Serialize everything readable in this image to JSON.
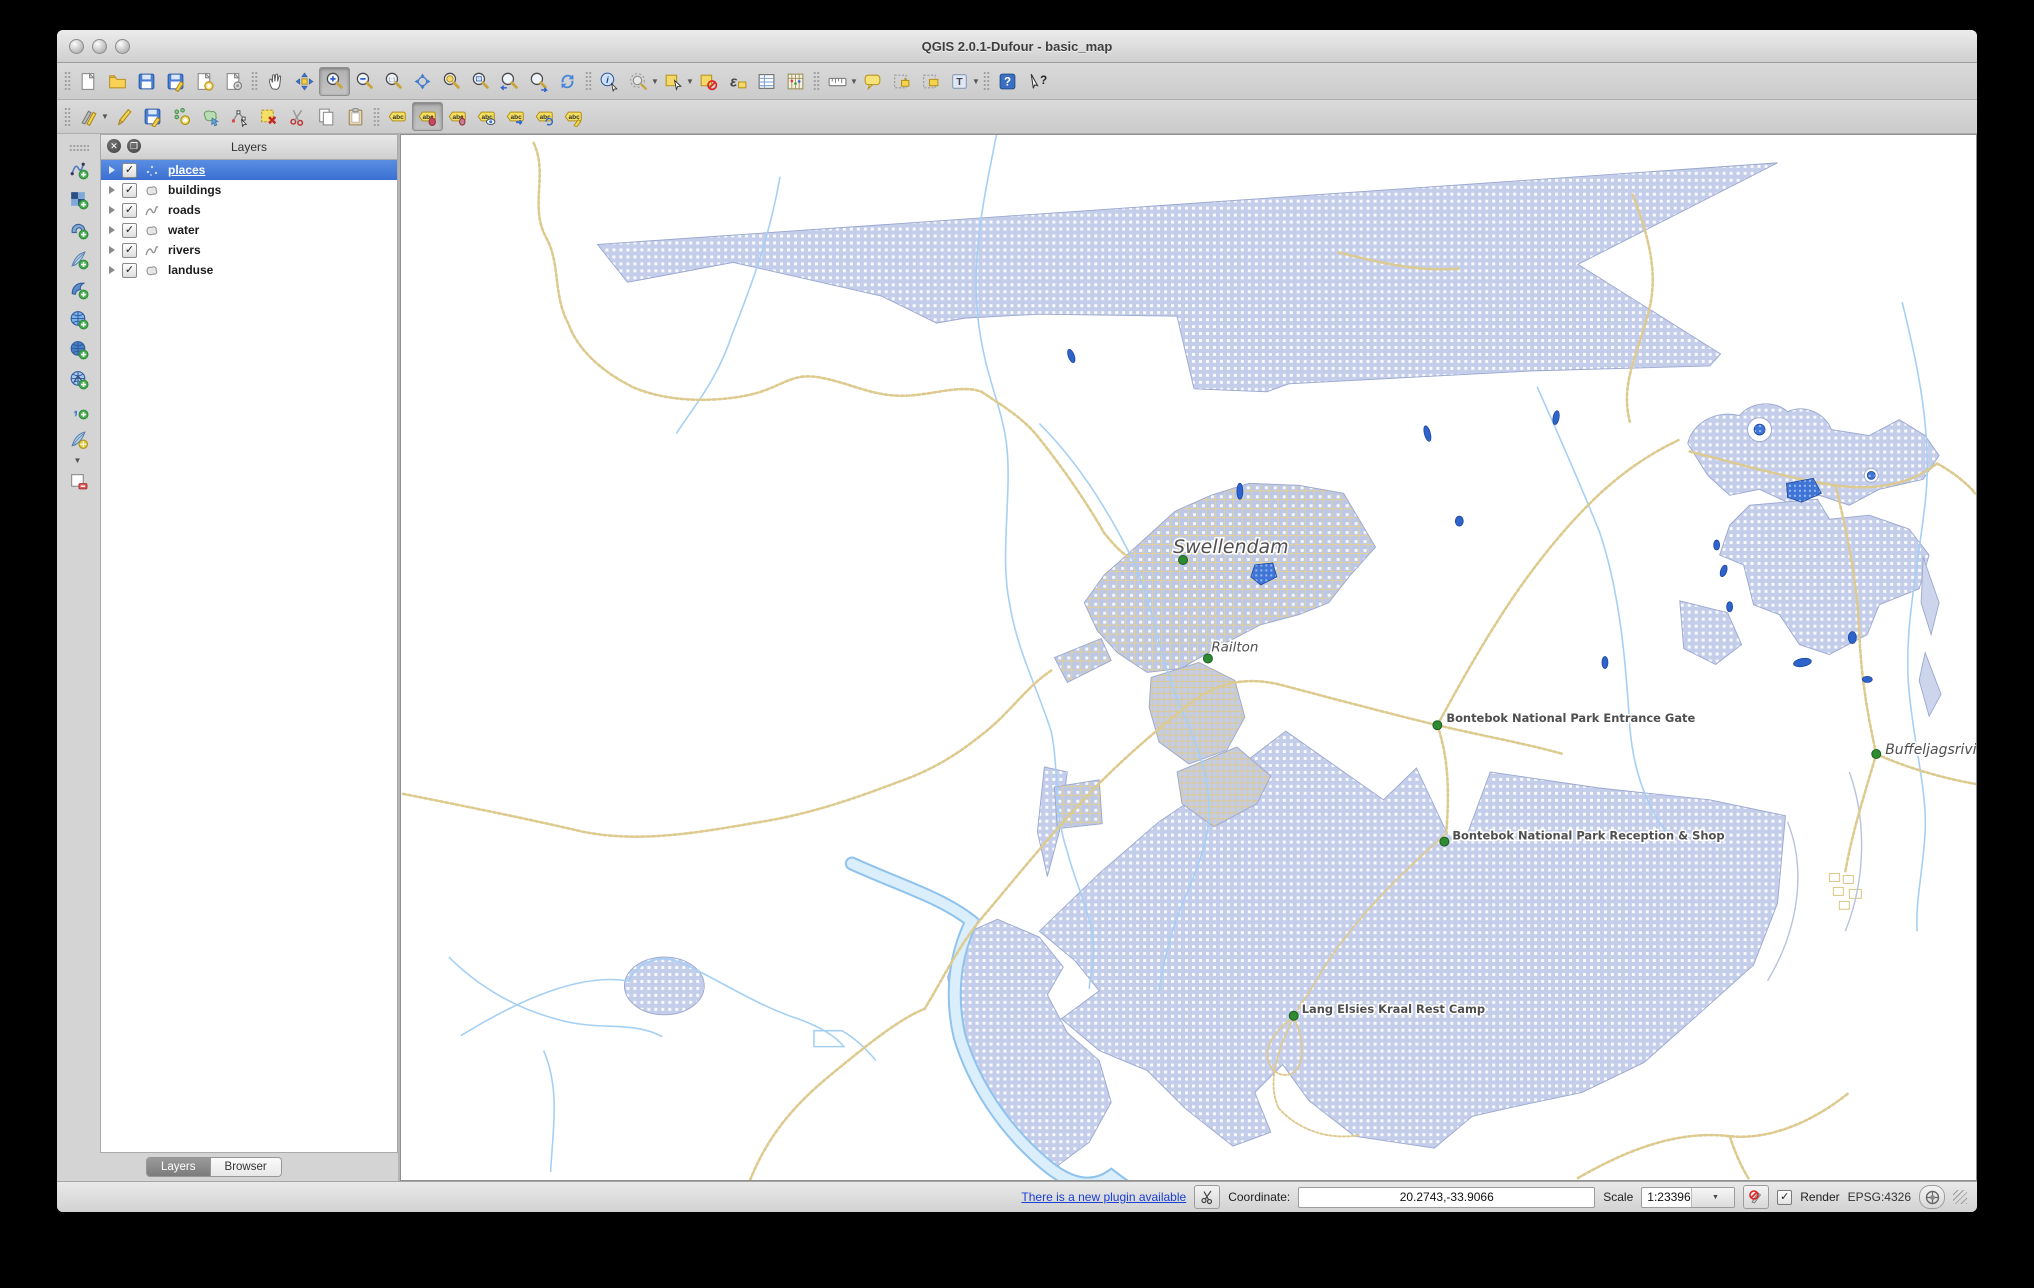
{
  "window": {
    "title": "QGIS 2.0.1-Dufour - basic_map"
  },
  "toolbar_main": [
    {
      "name": "new-project",
      "kind": "file"
    },
    {
      "name": "open-project",
      "kind": "folder"
    },
    {
      "name": "save-project",
      "kind": "floppy"
    },
    {
      "name": "save-project-as",
      "kind": "floppy-pencil"
    },
    {
      "name": "new-composer",
      "kind": "paper-star"
    },
    {
      "name": "composer-manager",
      "kind": "paper-gear"
    },
    {
      "sep": true
    },
    {
      "name": "pan-map",
      "kind": "hand"
    },
    {
      "name": "pan-to-selection",
      "kind": "pan"
    },
    {
      "name": "zoom-in",
      "kind": "mag-plus",
      "active": true
    },
    {
      "name": "zoom-out",
      "kind": "mag-minus"
    },
    {
      "name": "zoom-native",
      "kind": "mag-11"
    },
    {
      "name": "zoom-full",
      "kind": "zoomfull"
    },
    {
      "name": "zoom-to-selection",
      "kind": "mag-sel"
    },
    {
      "name": "zoom-to-layer",
      "kind": "mag-layer"
    },
    {
      "name": "zoom-last",
      "kind": "mag-last"
    },
    {
      "name": "zoom-next",
      "kind": "mag-next"
    },
    {
      "name": "refresh-map",
      "kind": "refresh"
    },
    {
      "sep": true
    },
    {
      "name": "identify-features",
      "kind": "identify"
    },
    {
      "name": "run-feature-action",
      "kind": "action",
      "dd": true
    },
    {
      "name": "select-features",
      "kind": "select",
      "dd": true
    },
    {
      "name": "deselect-features",
      "kind": "deselect"
    },
    {
      "name": "select-by-expression",
      "kind": "expression"
    },
    {
      "name": "open-attribute-table",
      "kind": "table"
    },
    {
      "name": "field-calculator",
      "kind": "calc"
    },
    {
      "sep": true
    },
    {
      "name": "measure",
      "kind": "measure",
      "dd": true
    },
    {
      "name": "map-tips",
      "kind": "bubble"
    },
    {
      "name": "new-bookmark",
      "kind": "bookmark-new"
    },
    {
      "name": "show-bookmarks",
      "kind": "bookmark-show"
    },
    {
      "name": "text-annotation",
      "kind": "textT",
      "dd": true
    },
    {
      "sep": true
    },
    {
      "name": "help",
      "kind": "help"
    },
    {
      "name": "whats-this",
      "kind": "whatsthis"
    }
  ],
  "toolbar_edit": [
    {
      "name": "current-edits",
      "kind": "edits",
      "dd": true
    },
    {
      "name": "toggle-editing",
      "kind": "pencil"
    },
    {
      "name": "save-layer-edits",
      "kind": "saveedits"
    },
    {
      "name": "add-feature",
      "kind": "addfeature"
    },
    {
      "name": "move-feature",
      "kind": "movefeature"
    },
    {
      "name": "node-tool",
      "kind": "nodetool"
    },
    {
      "name": "delete-selected",
      "kind": "delete"
    },
    {
      "name": "cut-features",
      "kind": "cut"
    },
    {
      "name": "copy-features",
      "kind": "copy"
    },
    {
      "name": "paste-features",
      "kind": "paste"
    },
    {
      "sep": true
    },
    {
      "name": "layer-labeling",
      "kind": "label-abc"
    },
    {
      "name": "pin-label",
      "kind": "label-pin",
      "active": true
    },
    {
      "name": "highlight-pinned-labels",
      "kind": "label-pin2"
    },
    {
      "name": "show-hide-labels",
      "kind": "label-eye"
    },
    {
      "name": "move-label",
      "kind": "label-arrow"
    },
    {
      "name": "rotate-label",
      "kind": "label-rotate"
    },
    {
      "name": "change-label",
      "kind": "label-edit"
    }
  ],
  "dock_left": [
    {
      "name": "add-vector-layer",
      "kind": "vline",
      "plus": true
    },
    {
      "name": "add-raster-layer",
      "kind": "checker",
      "plus": true
    },
    {
      "name": "add-postgis-layer",
      "kind": "elephant",
      "plus": true
    },
    {
      "name": "add-spatialite-layer",
      "kind": "feather",
      "plus": true
    },
    {
      "name": "add-mssql-layer",
      "kind": "shell",
      "plus": true
    },
    {
      "name": "add-wms-layer",
      "kind": "globe",
      "plus": true
    },
    {
      "name": "add-wcs-layer",
      "kind": "globe2",
      "plus": true
    },
    {
      "name": "add-wfs-layer",
      "kind": "globe3",
      "plus": true
    },
    {
      "name": "add-delimited-text-layer",
      "kind": "comma",
      "plus": true
    },
    {
      "name": "new-shapefile-layer",
      "kind": "newshp",
      "dd": true
    },
    {
      "name": "remove-layer",
      "kind": "removelayer"
    }
  ],
  "layers_panel": {
    "title": "Layers",
    "items": [
      {
        "label": "places",
        "type": "point",
        "checked": true,
        "selected": true
      },
      {
        "label": "buildings",
        "type": "polygon",
        "checked": true
      },
      {
        "label": "roads",
        "type": "line",
        "checked": true
      },
      {
        "label": "water",
        "type": "polygon",
        "checked": true
      },
      {
        "label": "rivers",
        "type": "line",
        "checked": true
      },
      {
        "label": "landuse",
        "type": "polygon",
        "checked": true
      }
    ]
  },
  "tabs": {
    "layers": "Layers",
    "browser": "Browser"
  },
  "statusbar": {
    "plugin_link": "There is a new plugin available",
    "coordinate_label": "Coordinate:",
    "coordinate_value": "20.2743,-33.9066",
    "scale_label": "Scale",
    "scale_value": "1:23396",
    "render_label": "Render",
    "render_checked": "✓",
    "crs": "EPSG:4326"
  },
  "map": {
    "colors": {
      "landuse_fill": "#c4cdea",
      "urban_fill": "#bdc8e8",
      "road": "#ddca8e",
      "river": "#a5d0f4",
      "water_fill": "#2f63cc",
      "label_text": "#4f4f4f",
      "place_marker": "#2e8b32"
    },
    "labels": [
      {
        "text": "Swellendam"
      },
      {
        "text": "Railton"
      },
      {
        "text": "Bontebok National Park Entrance Gate"
      },
      {
        "text": "Buffeljagsrivier"
      },
      {
        "text": "Bontebok National Park Reception & Shop"
      },
      {
        "text": "Lang Elsies Kraal Rest Camp"
      }
    ]
  }
}
